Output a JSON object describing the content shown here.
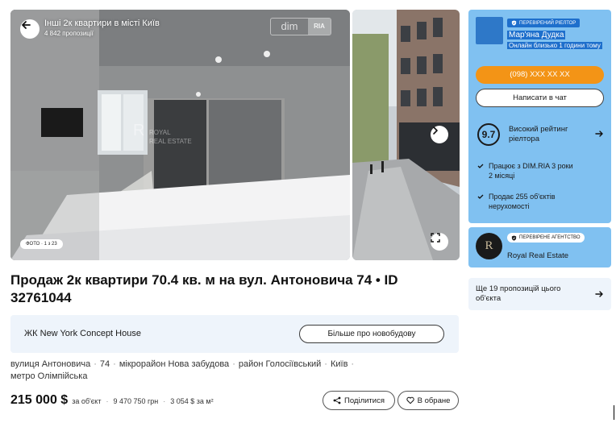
{
  "gallery": {
    "title": "Інші 2к квартири в місті Київ",
    "count": "4 842 пропозиції",
    "logo_left": "dim",
    "logo_right": "RIA",
    "photo_counter": "ФОТО · 1 з 23",
    "watermark_line1": "ROYAL",
    "watermark_line2": "REAL ESTATE",
    "watermark_mark": "R"
  },
  "listing": {
    "title": "Продаж 2к квартири 70.4 кв. м на вул. Антоновича 74 • ID 32761044"
  },
  "complex": {
    "name": "ЖК New York Concept House",
    "button": "Більше про новобудову"
  },
  "address": {
    "parts": [
      "вулиця Антоновича",
      "74",
      "мікрорайон Нова забудова",
      "район Голосіївський",
      "Київ",
      "метро Олімпійська"
    ]
  },
  "price": {
    "value": "215 000 $",
    "unit": "за об'єкт",
    "uah": "9 470 750 грн",
    "per_sqm": "3 054 $ за м²"
  },
  "actions": {
    "share": "Поділитися",
    "favorite": "В обране"
  },
  "agent": {
    "badge": "ПЕРЕВІРЕНИЙ РІЕЛТОР",
    "name": "Мар'яна Дудка",
    "status": "Онлайн близько 1 години тому",
    "phone": "(098) XXX XX XX",
    "chat": "Написати в чат",
    "rating": "9.7",
    "rating_text": "Високий рейтинг ріелтора",
    "fact1": "Працює з DIM.RIA 3 роки 2 місяці",
    "fact2": "Продає 255 об'єктів нерухомості"
  },
  "agency": {
    "logo": "R",
    "badge": "ПЕРЕВІРЕНЕ АГЕНТСТВО",
    "name": "Royal Real Estate"
  },
  "more_offers": {
    "text": "Ще 19 пропозицій цього об'єкта"
  },
  "colors": {
    "agent_card": "#80c1f1",
    "phone_button": "#f39416",
    "verified": "#1e6fcc",
    "banner": "#eef4fb"
  }
}
